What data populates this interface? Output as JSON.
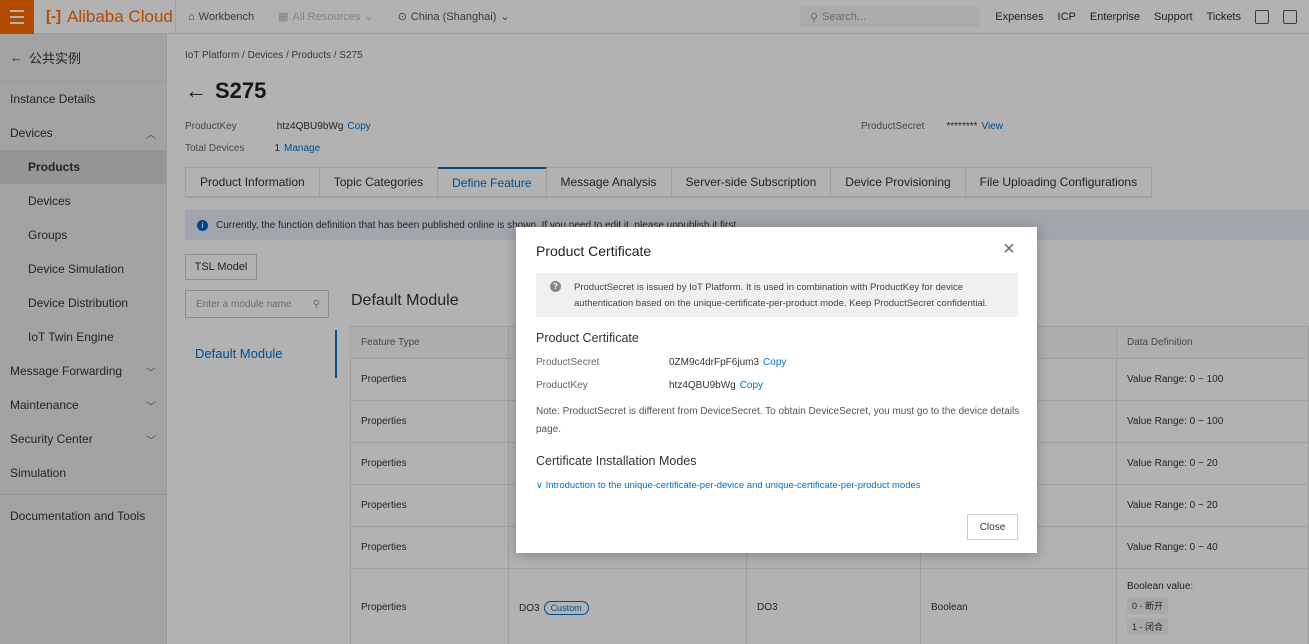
{
  "topbar": {
    "brand": "Alibaba Cloud",
    "workbench": "Workbench",
    "all_resources": "All Resources",
    "region": "China (Shanghai)",
    "search_placeholder": "Search...",
    "links": [
      "Expenses",
      "ICP",
      "Enterprise",
      "Support",
      "Tickets"
    ]
  },
  "sidebar": {
    "back_label": "公共实例",
    "items": [
      {
        "label": "Instance Details"
      },
      {
        "label": "Devices"
      },
      {
        "label": "Products"
      },
      {
        "label": "Devices"
      },
      {
        "label": "Groups"
      },
      {
        "label": "Device Simulation"
      },
      {
        "label": "Device Distribution"
      },
      {
        "label": "IoT Twin Engine"
      },
      {
        "label": "Message Forwarding"
      },
      {
        "label": "Maintenance"
      },
      {
        "label": "Security Center"
      },
      {
        "label": "Simulation"
      },
      {
        "label": "Documentation and Tools"
      }
    ]
  },
  "main": {
    "breadcrumb": "IoT Platform / Devices / Products / S275",
    "title": "S275",
    "product_key_label": "ProductKey",
    "product_key_value": "htz4QBU9bWg",
    "copy_label": "Copy",
    "total_devices_label": "Total Devices",
    "total_devices_value": "1",
    "manage_label": "Manage",
    "product_secret_label": "ProductSecret",
    "product_secret_masked": "********",
    "view_label": "View",
    "tabs": [
      {
        "label": "Product Information"
      },
      {
        "label": "Topic Categories"
      },
      {
        "label": "Define Feature"
      },
      {
        "label": "Message Analysis"
      },
      {
        "label": "Server-side Subscription"
      },
      {
        "label": "Device Provisioning"
      },
      {
        "label": "File Uploading Configurations"
      }
    ],
    "notice": "Currently, the function definition that has been published online is shown. If you need to edit it, please unpublish it first.",
    "tsl_button": "TSL Model",
    "module_search_placeholder": "Enter a module name",
    "module_heading": "Default Module",
    "module_list_item": "Default Module",
    "table": {
      "headers": [
        "Feature Type",
        "",
        "",
        "",
        "Data Definition"
      ],
      "rows": [
        {
          "type": "Properties",
          "def": "Value Range: 0 ~ 100"
        },
        {
          "type": "Properties",
          "def": "Value Range: 0 ~ 100"
        },
        {
          "type": "Properties",
          "def": "Value Range: 0 ~ 20"
        },
        {
          "type": "Properties",
          "def": "Value Range: 0 ~ 20"
        },
        {
          "type": "Properties",
          "def": "Value Range: 0 ~ 40"
        }
      ],
      "last_row": {
        "type": "Properties",
        "name": "DO3",
        "tag": "Custom",
        "identifier": "DO3",
        "data_type": "Boolean",
        "def_title": "Boolean value:",
        "def_0": "0 - 断开",
        "def_1": "1 - 闭合"
      }
    }
  },
  "modal": {
    "title": "Product Certificate",
    "alert": "ProductSecret is issued by IoT Platform. It is used in combination with ProductKey for device authentication based on the unique-certificate-per-product mode. Keep ProductSecret confidential.",
    "section_title": "Product Certificate",
    "product_secret_label": "ProductSecret",
    "product_secret_value": "0ZM9c4drFpF6jum3",
    "product_key_label": "ProductKey",
    "product_key_value": "htz4QBU9bWg",
    "copy_label": "Copy",
    "note": "Note: ProductSecret is different from DeviceSecret. To obtain DeviceSecret, you must go to the device details page.",
    "install_title": "Certificate Installation Modes",
    "install_link": "Introduction to the unique-certificate-per-device and unique-certificate-per-product modes",
    "close_button": "Close"
  }
}
